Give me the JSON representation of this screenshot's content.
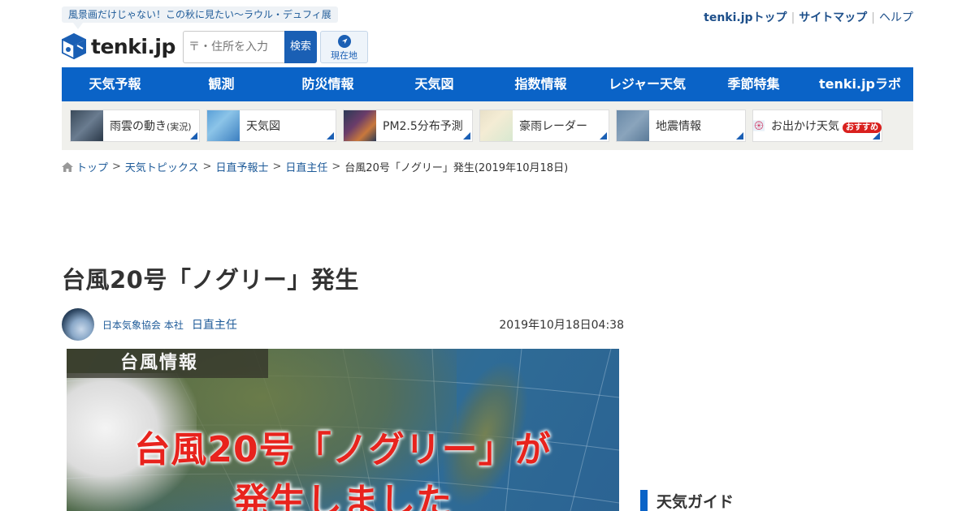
{
  "promo": {
    "text": "風景画だけじゃない！この秋に見たい〜ラウル・デュフィ展"
  },
  "top_links": [
    {
      "label": "tenki.jpトップ"
    },
    {
      "label": "サイトマップ"
    },
    {
      "label": "ヘルプ"
    }
  ],
  "logo": {
    "text": "tenki.jp"
  },
  "search": {
    "placeholder": "〒・住所を入力",
    "button": "検索"
  },
  "location_button": {
    "label": "現在地"
  },
  "nav": [
    {
      "label": "天気予報"
    },
    {
      "label": "観測"
    },
    {
      "label": "防災情報"
    },
    {
      "label": "天気図"
    },
    {
      "label": "指数情報"
    },
    {
      "label": "レジャー天気"
    },
    {
      "label": "季節特集"
    },
    {
      "label": "tenki.jpラボ"
    }
  ],
  "tiles": [
    {
      "label": "雨雲の動き",
      "sub": "(実況)"
    },
    {
      "label": "天気図"
    },
    {
      "label": "PM2.5分布予測"
    },
    {
      "label": "豪雨レーダー"
    },
    {
      "label": "地震情報"
    },
    {
      "label": "お出かけ天気",
      "badge": "おすすめ"
    }
  ],
  "breadcrumb": [
    {
      "label": "トップ"
    },
    {
      "label": "天気トピックス"
    },
    {
      "label": "日直予報士"
    },
    {
      "label": "日直主任"
    },
    {
      "label": "台風20号「ノグリー」発生(2019年10月18日)"
    }
  ],
  "article": {
    "title": "台風20号「ノグリー」発生",
    "org": "日本気象協会 本社",
    "author": "日直主任",
    "date": "2019年10月18日04:38",
    "hero": {
      "label": "台風情報",
      "line1": "台風20号「ノグリー」が",
      "line2": "発生しました"
    }
  },
  "sidebar": {
    "heading": "天気ガイド"
  },
  "colors": {
    "brand": "#0a63c7",
    "link": "#1d5a98",
    "hero_text": "#e8231d",
    "badge": "#d9201e"
  }
}
